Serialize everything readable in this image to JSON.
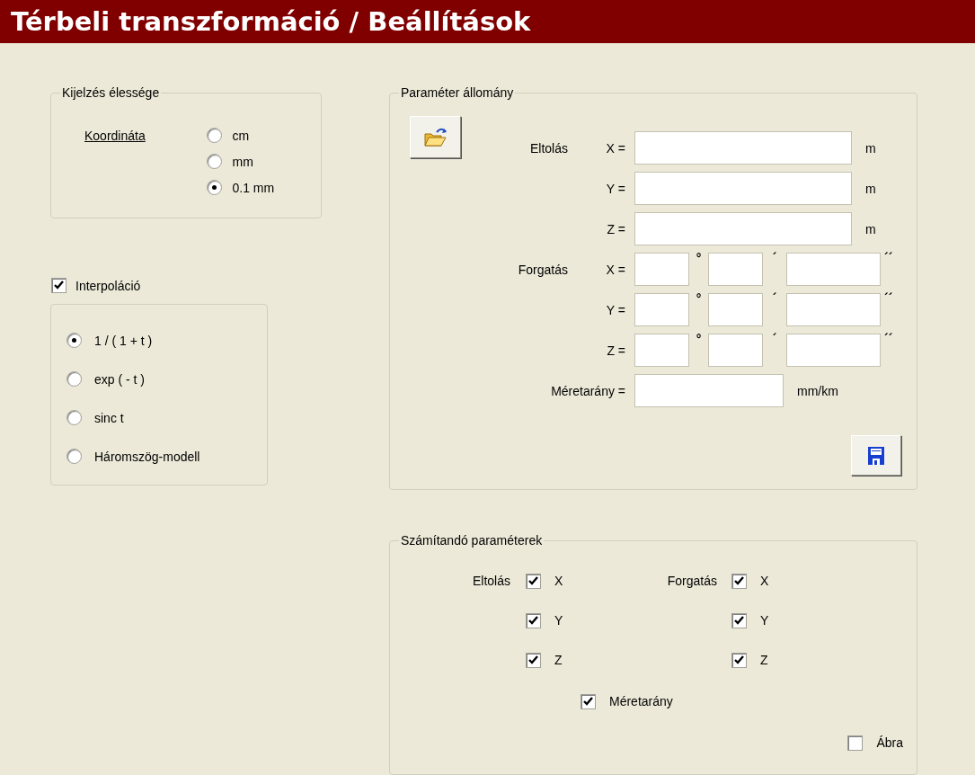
{
  "header": {
    "title": "Térbeli transzformáció / Beállítások"
  },
  "display_precision": {
    "title": "Kijelzés élessége",
    "label": "Koordináta",
    "options": [
      {
        "label": "cm",
        "selected": false
      },
      {
        "label": "mm",
        "selected": false
      },
      {
        "label": "0.1 mm",
        "selected": true
      }
    ]
  },
  "interpolation": {
    "label": "Interpoláció",
    "checked": true,
    "options": [
      {
        "label": "1 / ( 1 + t )",
        "selected": true
      },
      {
        "label": "exp ( - t )",
        "selected": false
      },
      {
        "label": "sinc t",
        "selected": false
      },
      {
        "label": "Háromszög-modell",
        "selected": false
      }
    ]
  },
  "parameter_file": {
    "title": "Paraméter állomány",
    "translation": {
      "label": "Eltolás",
      "rows": [
        {
          "axis": "X =",
          "unit": "m"
        },
        {
          "axis": "Y =",
          "unit": "m"
        },
        {
          "axis": "Z =",
          "unit": "m"
        }
      ]
    },
    "rotation": {
      "label": "Forgatás",
      "rows": [
        {
          "axis": "X =",
          "marks": [
            "°",
            "´",
            "´´"
          ]
        },
        {
          "axis": "Y =",
          "marks": [
            "°",
            "´",
            "´´"
          ]
        },
        {
          "axis": "Z =",
          "marks": [
            "°",
            "´",
            "´´"
          ]
        }
      ]
    },
    "scale": {
      "label": "Méretarány =",
      "unit": "mm/km"
    }
  },
  "computed": {
    "title": "Számítandó paraméterek",
    "translation": {
      "label": "Eltolás",
      "items": [
        {
          "label": "X",
          "checked": true
        },
        {
          "label": "Y",
          "checked": true
        },
        {
          "label": "Z",
          "checked": true
        }
      ]
    },
    "rotation": {
      "label": "Forgatás",
      "items": [
        {
          "label": "X",
          "checked": true
        },
        {
          "label": "Y",
          "checked": true
        },
        {
          "label": "Z",
          "checked": true
        }
      ]
    },
    "scale": {
      "label": "Méretarány",
      "checked": true
    },
    "figure": {
      "label": "Ábra",
      "checked": false
    }
  }
}
